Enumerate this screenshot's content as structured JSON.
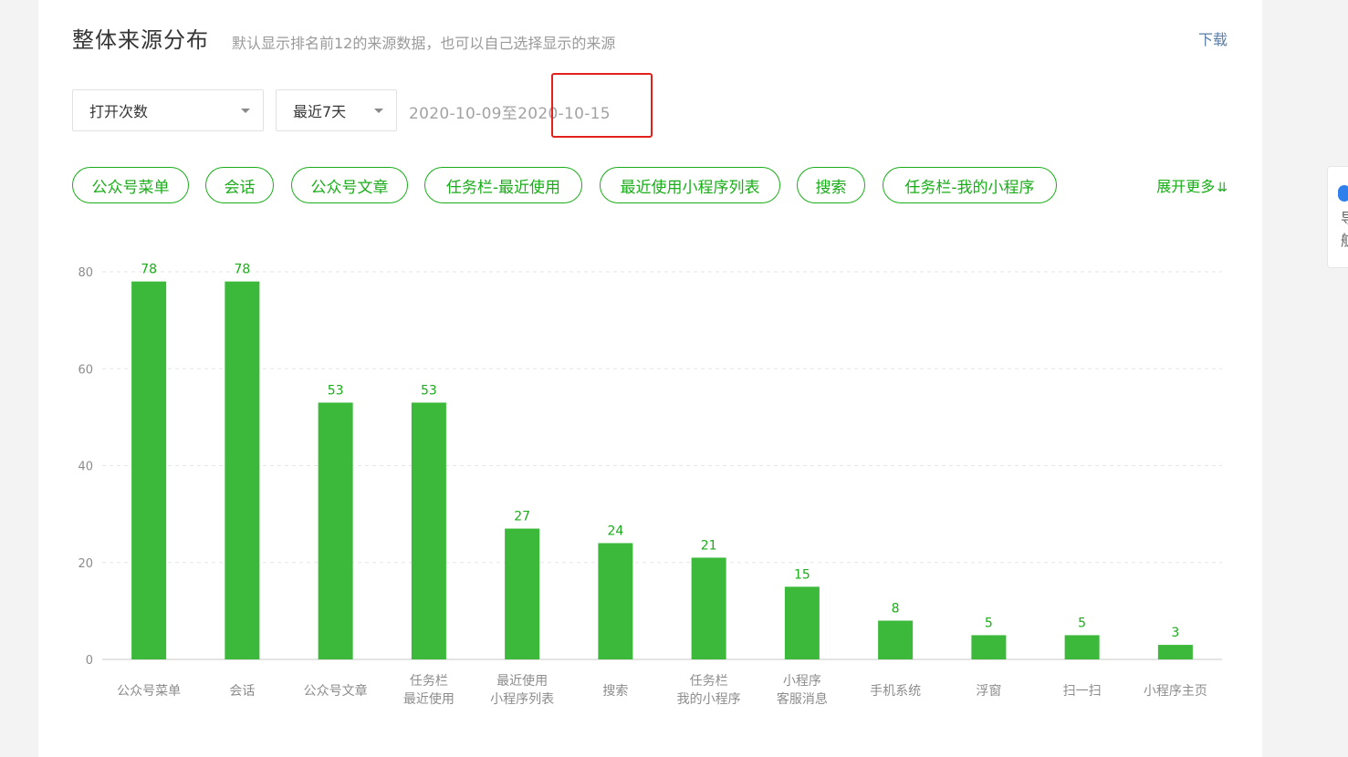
{
  "header": {
    "title": "整体来源分布",
    "subtitle": "默认显示排名前12的来源数据，也可以自己选择显示的来源",
    "download_label": "下载"
  },
  "filters": {
    "metric_selected": "打开次数",
    "period_selected": "最近7天",
    "date_range": "2020-10-09至2020-10-15"
  },
  "source_chips": [
    "公众号菜单",
    "会话",
    "公众号文章",
    "任务栏-最近使用",
    "最近使用小程序列表",
    "搜索",
    "任务栏-我的小程序"
  ],
  "expand_label": "展开更多",
  "side_tab": {
    "line1": "导",
    "line2": "航"
  },
  "colors": {
    "accent": "#1aad19",
    "bar": "#3cb93a",
    "highlight": "#e3211c",
    "link": "#5a7ea8"
  },
  "chart_data": {
    "type": "bar",
    "title": "",
    "xlabel": "",
    "ylabel": "",
    "categories": [
      [
        "公众号菜单"
      ],
      [
        "会话"
      ],
      [
        "公众号文章"
      ],
      [
        "任务栏",
        "最近使用"
      ],
      [
        "最近使用",
        "小程序列表"
      ],
      [
        "搜索"
      ],
      [
        "任务栏",
        "我的小程序"
      ],
      [
        "小程序",
        "客服消息"
      ],
      [
        "手机系统"
      ],
      [
        "浮窗"
      ],
      [
        "扫一扫"
      ],
      [
        "小程序主页"
      ]
    ],
    "values": [
      78,
      78,
      53,
      53,
      27,
      24,
      21,
      15,
      8,
      5,
      5,
      3
    ],
    "ylim": [
      0,
      80
    ],
    "yticks": [
      0,
      20,
      40,
      60,
      80
    ],
    "grid": true,
    "show_data_labels": true
  }
}
